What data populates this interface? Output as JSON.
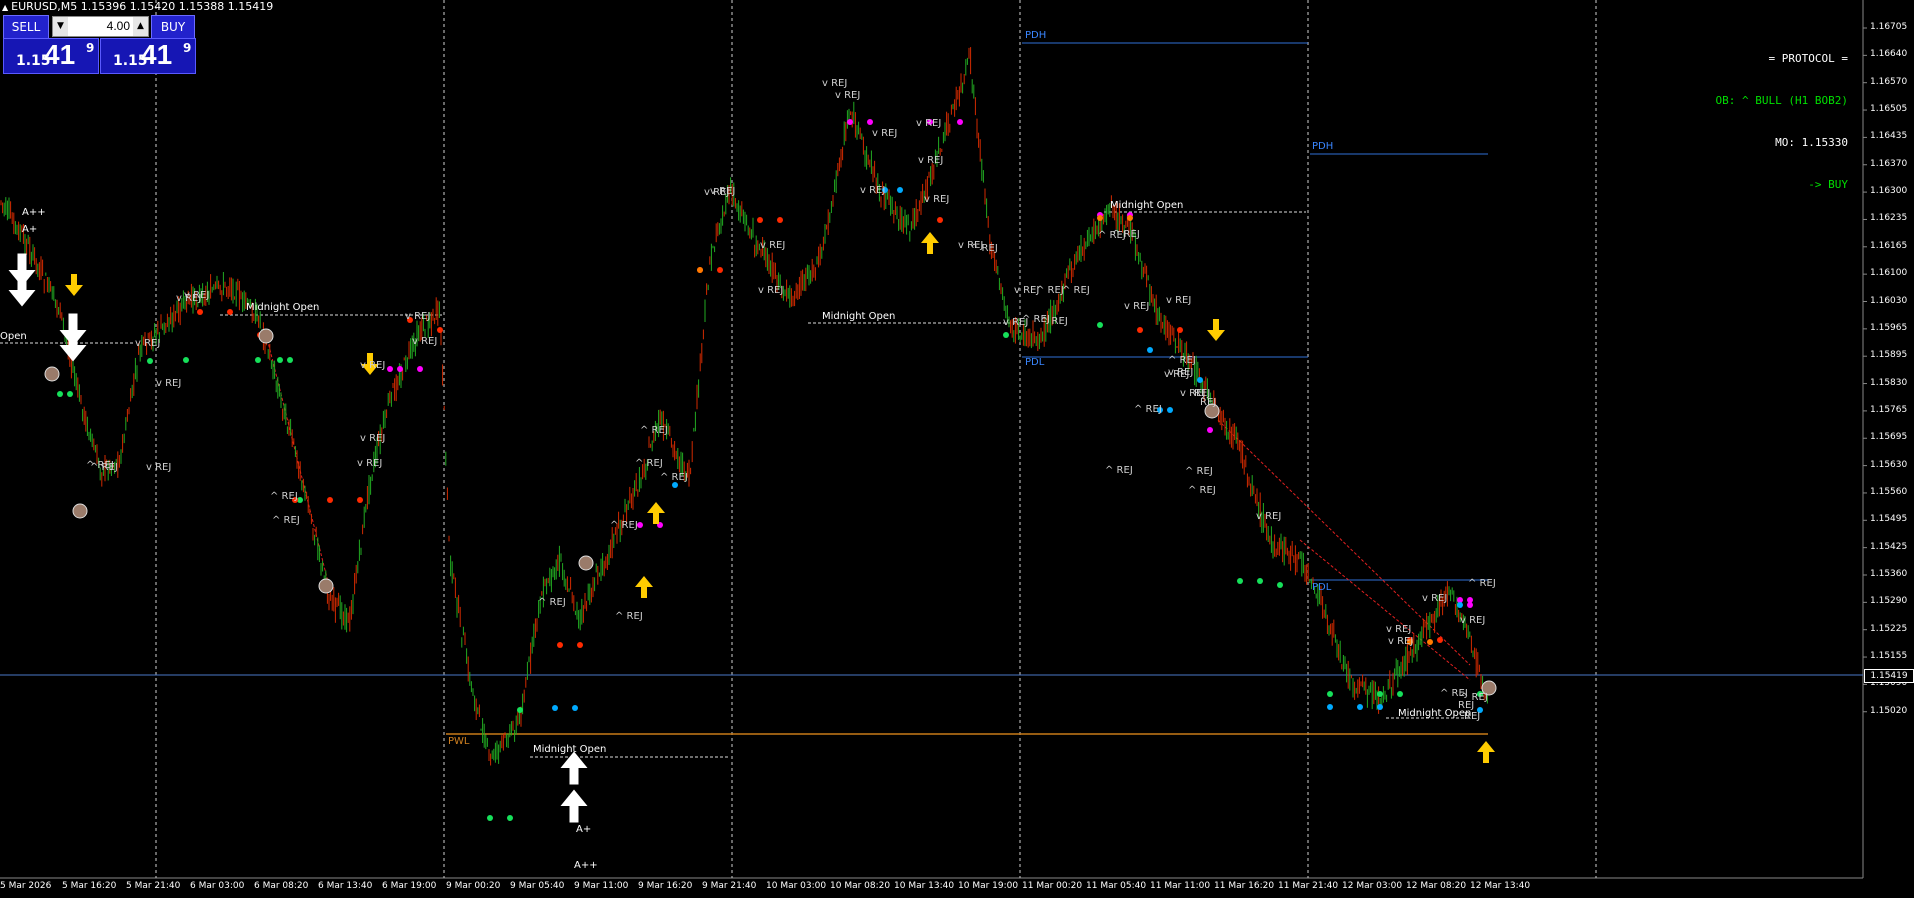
{
  "window": {
    "symbol_title": "EURUSD,M5  1.15396 1.15420 1.15388 1.15419"
  },
  "trade_panel": {
    "sell_label": "SELL",
    "buy_label": "BUY",
    "lot_value": "4.00",
    "sell_quote": {
      "prefix": "1.15",
      "big": "41",
      "sup": "9"
    },
    "buy_quote": {
      "prefix": "1.15",
      "big": "41",
      "sup": "9"
    }
  },
  "protocol": {
    "line1": "= PROTOCOL =",
    "line2": "OB: ^ BULL (H1 BOB2)",
    "line3": "MO: 1.15330",
    "line4": "-> BUY",
    "colors": {
      "header": "#ffffff",
      "ob": "#00e000",
      "mo": "#ffffff",
      "signal": "#00e000"
    }
  },
  "price_axis": {
    "ticks": [
      "1.16705",
      "1.16640",
      "1.16570",
      "1.16505",
      "1.16435",
      "1.16370",
      "1.16300",
      "1.16235",
      "1.16165",
      "1.16100",
      "1.16030",
      "1.15965",
      "1.15895",
      "1.15830",
      "1.15765",
      "1.15695",
      "1.15630",
      "1.15560",
      "1.15495",
      "1.15425",
      "1.15360",
      "1.15290",
      "1.15225",
      "1.15155",
      "1.15090",
      "1.15020"
    ],
    "current_price": "1.15419"
  },
  "time_axis": {
    "ticks": [
      "5 Mar 2026",
      "5 Mar 16:20",
      "5 Mar 21:40",
      "6 Mar 03:00",
      "6 Mar 08:20",
      "6 Mar 13:40",
      "6 Mar 19:00",
      "9 Mar 00:20",
      "9 Mar 05:40",
      "9 Mar 11:00",
      "9 Mar 16:20",
      "9 Mar 21:40",
      "10 Mar 03:00",
      "10 Mar 08:20",
      "10 Mar 13:40",
      "10 Mar 19:00",
      "11 Mar 00:20",
      "11 Mar 05:40",
      "11 Mar 11:00",
      "11 Mar 16:20",
      "11 Mar 21:40",
      "12 Mar 03:00",
      "12 Mar 08:20",
      "12 Mar 13:40"
    ]
  },
  "levels": {
    "pdh1": "PDH",
    "pdh2": "PDH",
    "pdl1": "PDL",
    "pdl2": "PDL",
    "pwl": "PWL",
    "midnight_open": "Midnight Open",
    "open_left": "Open"
  },
  "markers": {
    "rej_down": "v REJ",
    "rej_up": "^ REJ",
    "rej_plain": "REJ",
    "grade_app": "A++",
    "grade_ap": "A+"
  },
  "colors": {
    "background": "#000000",
    "bull_candle": "#22aa22",
    "bear_candle": "#d22a00",
    "level_line": "#2f6fd6",
    "pwl_line": "#c87a18",
    "arrow_yellow": "#ffcc00",
    "arrow_white": "#ffffff",
    "dot_green": "#16e05a",
    "dot_red": "#ff2a00",
    "dot_magenta": "#ff00ff",
    "dot_cyan": "#00aaff",
    "dot_orange": "#ff7a00"
  }
}
